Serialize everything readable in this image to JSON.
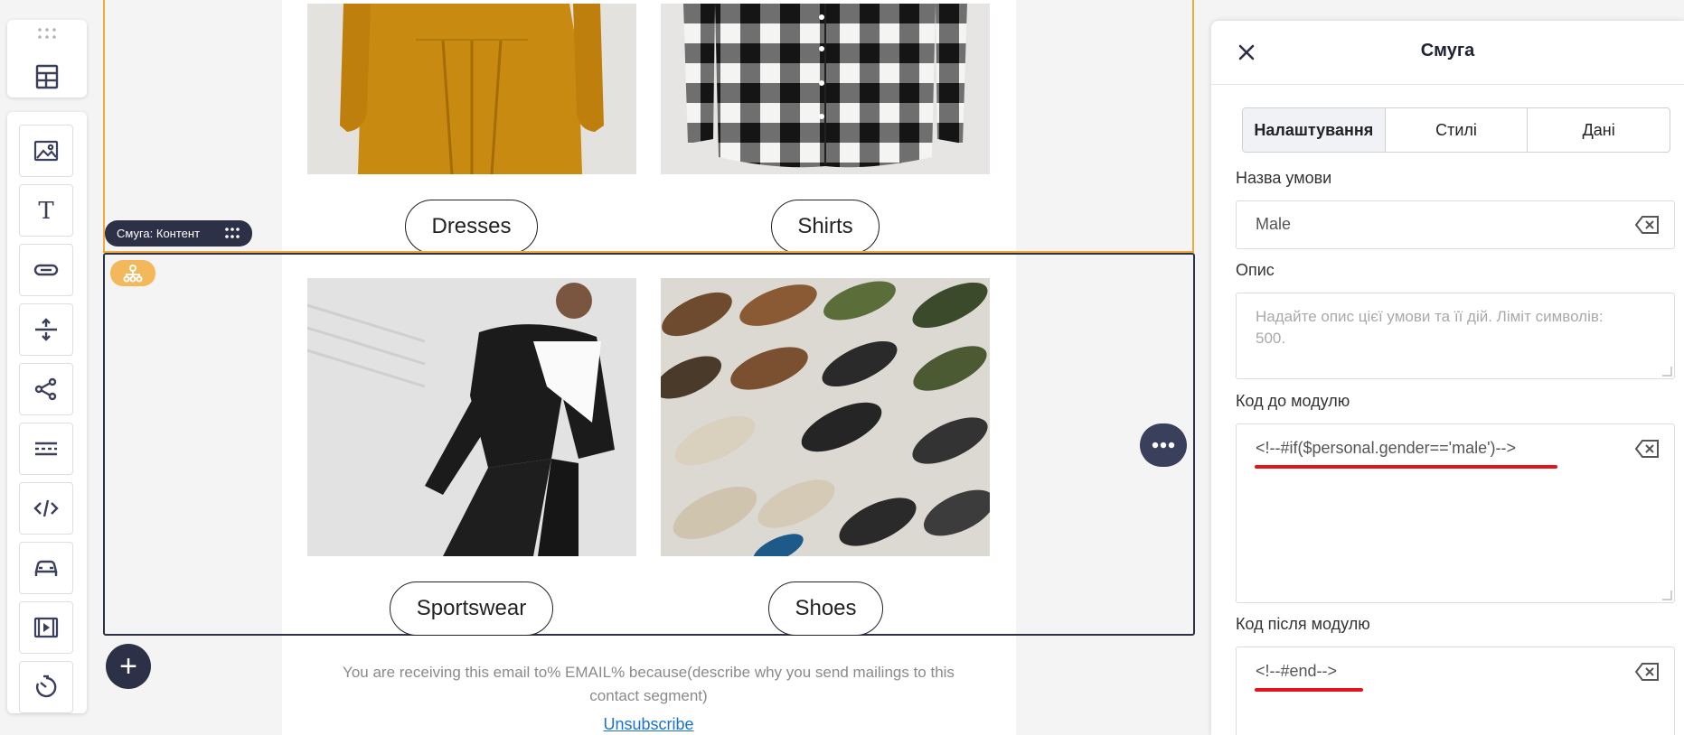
{
  "canvas": {
    "products": [
      {
        "label": "Dresses"
      },
      {
        "label": "Shirts"
      },
      {
        "label": "Sportswear"
      },
      {
        "label": "Shoes"
      }
    ],
    "stripe_label": "Смуга: Контент",
    "add_icon": "+",
    "footer_text": "You are receiving this email to% EMAIL% because(describe why you send mailings to this contact segment)",
    "unsubscribe": "Unsubscribe"
  },
  "toolbar": {
    "top_icon": "layout-icon",
    "tools": [
      "image-icon",
      "text-icon",
      "button-icon",
      "spacer-icon",
      "social-icon",
      "divider-icon",
      "html-code-icon",
      "car-icon",
      "video-icon",
      "timer-icon"
    ]
  },
  "panel": {
    "title": "Смуга",
    "tabs": [
      "Налаштування",
      "Стилі",
      "Дані"
    ],
    "active_tab": "Налаштування",
    "condition_name_label": "Назва умови",
    "condition_name_value": "Male",
    "description_label": "Опис",
    "description_placeholder": "Надайте опис цієї умови та її дій. Ліміт символів: 500.",
    "code_before_label": "Код до модулю",
    "code_before_value": "<!--#if($personal.gender=='male')-->",
    "code_after_label": "Код після модулю",
    "code_after_value": "<!--#end-->"
  },
  "colors": {
    "accent_orange": "#f2a93b",
    "dark_navy": "#2c3148",
    "annotation_red": "#e3141b"
  }
}
